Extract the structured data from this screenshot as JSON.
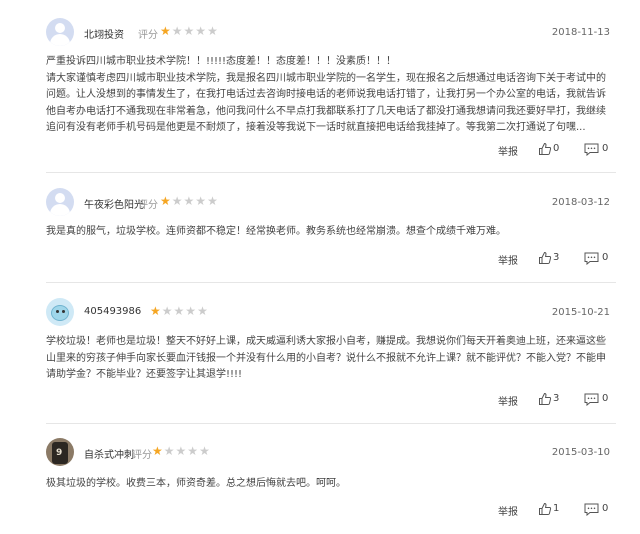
{
  "review_label": "评分",
  "report_label": "举报",
  "colors": {
    "star_on": "#f5a623",
    "star_off": "#cccccc"
  },
  "reviews": [
    {
      "user": "北翊投资",
      "rating": 1,
      "date": "2018-11-13",
      "text": "严重投诉四川城市职业技术学院！！!!!!!态度差！！态度差！！！没素质！！！\n请大家谨慎考虑四川城市职业技术学院，我是报名四川城市职业学院的一名学生，现在报名之后想通过电话咨询下关于考试中的问题。让人没想到的事情发生了，在我打电话过去咨询时接电话的老师说我电话打错了，让我打另一个办公室的电话，我就告诉他自考办电话打不通我现在非常着急，他问我问什么不早点打我都联系打了几天电话了都没打通我想请问我还要好早打，我继续追问有没有老师手机号码是他更是不耐烦了，接着没等我说下一话时就直接把电话给我挂掉了。等我第二次打通说了句嘿...",
      "likes": "0",
      "comments": "0",
      "avatar_icon": "default-avatar-icon"
    },
    {
      "user": "午夜彩色阳光",
      "rating": 1,
      "date": "2018-03-12",
      "text": "我是真的服气，垃圾学校。连师资都不稳定！经常换老师。教务系统也经常崩溃。想查个成绩千难万难。",
      "likes": "3",
      "comments": "0",
      "avatar_icon": "default-avatar-icon"
    },
    {
      "user": "405493986",
      "rating": 1,
      "date": "2015-10-21",
      "text": "学校垃圾！老师也是垃圾！整天不好好上课，成天威逼利诱大家报小自考，赚提成。我想说你们每天开着奥迪上班，还来逼这些山里来的穷孩子伸手向家长要血汗钱报一个并没有什么用的小自考？说什么不报就不允许上课？就不能评优？不能入党？不能申请助学金？不能毕业？还要签字让其退学!!!!",
      "likes": "3",
      "comments": "0",
      "avatar_icon": "cartoon-avatar-icon"
    },
    {
      "user": "自杀式冲刺",
      "rating": 1,
      "date": "2015-03-10",
      "text": "极其垃圾的学校。收费三本，师资奇差。总之想后悔就去吧。呵呵。",
      "likes": "1",
      "comments": "0",
      "avatar_icon": "photo-avatar-icon"
    }
  ]
}
